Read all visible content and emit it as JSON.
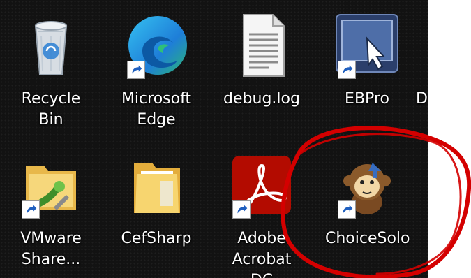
{
  "desktop": {
    "icons": [
      {
        "label": "Recycle Bin",
        "icon": "recycle-bin-icon",
        "shortcut": false
      },
      {
        "label": "Microsoft Edge",
        "icon": "edge-icon",
        "shortcut": true
      },
      {
        "label": "debug.log",
        "icon": "text-file-icon",
        "shortcut": false
      },
      {
        "label": "EBPro",
        "icon": "ebpro-icon",
        "shortcut": true
      },
      {
        "label": "VMware Share...",
        "icon": "vmware-share-folder-icon",
        "shortcut": true
      },
      {
        "label": "CefSharp",
        "icon": "folder-icon",
        "shortcut": false
      },
      {
        "label": "Adobe Acrobat DC",
        "icon": "acrobat-icon",
        "shortcut": true
      },
      {
        "label": "ChoiceSolo",
        "icon": "monkey-icon",
        "shortcut": true
      }
    ],
    "partial_label_right_edge": "D"
  },
  "annotation": {
    "color": "#d40000",
    "type": "freehand-circle"
  }
}
